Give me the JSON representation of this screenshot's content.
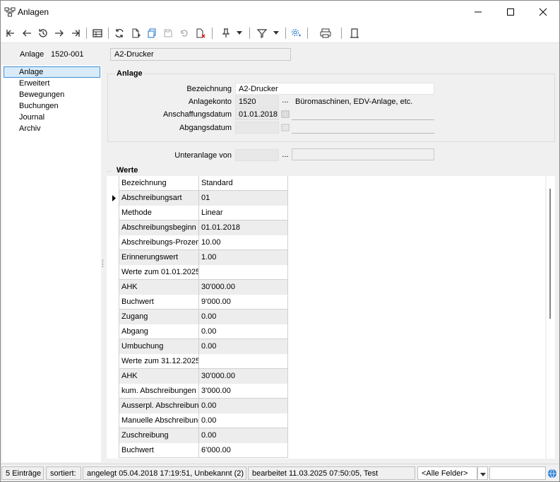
{
  "window": {
    "title": "Anlagen"
  },
  "header": {
    "label": "Anlage",
    "number": "1520-001",
    "name": "A2-Drucker"
  },
  "nav": {
    "items": [
      "Anlage",
      "Erweitert",
      "Bewegungen",
      "Buchungen",
      "Journal",
      "Archiv"
    ]
  },
  "anlage_group": {
    "title": "Anlage",
    "bezeichnung_label": "Bezeichnung",
    "bezeichnung_value": "A2-Drucker",
    "anlagekonto_label": "Anlagekonto",
    "anlagekonto_value": "1520",
    "anlagekonto_desc": "Büromaschinen, EDV-Anlage, etc.",
    "anschaffung_label": "Anschaffungsdatum",
    "anschaffung_value": "01.01.2018",
    "abgang_label": "Abgangsdatum",
    "abgang_value": ""
  },
  "unteranlage": {
    "label": "Unteranlage von",
    "value": "",
    "ellipsis": "..."
  },
  "werte": {
    "title": "Werte",
    "rows": [
      [
        "Bezeichnung",
        "Standard"
      ],
      [
        "Abschreibungsart",
        "01"
      ],
      [
        "Methode",
        "Linear"
      ],
      [
        "Abschreibungsbeginn",
        "01.01.2018"
      ],
      [
        "Abschreibungs-Prozent",
        "10.00"
      ],
      [
        "Erinnerungswert",
        "1.00"
      ],
      [
        "Werte zum 01.01.2025",
        ""
      ],
      [
        "AHK",
        "30'000.00"
      ],
      [
        "Buchwert",
        "9'000.00"
      ],
      [
        "Zugang",
        "0.00"
      ],
      [
        "Abgang",
        "0.00"
      ],
      [
        "Umbuchung",
        "0.00"
      ],
      [
        "Werte zum 31.12.2025",
        ""
      ],
      [
        "AHK",
        "30'000.00"
      ],
      [
        "kum. Abschreibungen",
        "3'000.00"
      ],
      [
        "Ausserpl. Abschreibungen",
        "0.00"
      ],
      [
        "Manuelle Abschreibung",
        "0.00"
      ],
      [
        "Zuschreibung",
        "0.00"
      ],
      [
        "Buchwert",
        "6'000.00"
      ]
    ],
    "alt_rows": [
      1,
      3,
      5,
      7,
      9,
      11,
      13,
      15,
      17
    ]
  },
  "status": {
    "count": "5 Einträge",
    "sorted": "sortiert:",
    "created": "angelegt 05.04.2018 17:19:51, Unbekannt (2)",
    "edited": "bearbeitet 11.03.2025 07:50:05, Test",
    "filter": "<Alle Felder>",
    "search": ""
  }
}
